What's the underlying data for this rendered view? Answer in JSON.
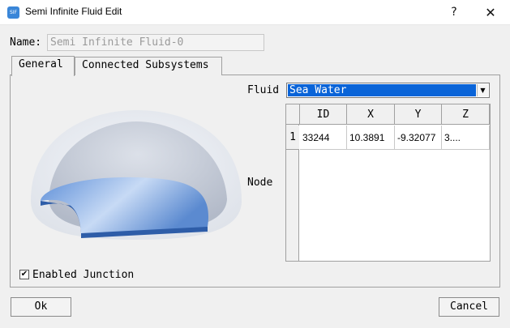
{
  "window": {
    "title": "Semi Infinite Fluid Edit",
    "icon_text": "SIF",
    "help_glyph": "?",
    "close_glyph": "✕"
  },
  "name": {
    "label": "Name:",
    "value": "Semi Infinite Fluid-0"
  },
  "tabs": [
    {
      "label": "General",
      "active": true
    },
    {
      "label": "Connected Subsystems",
      "active": false
    }
  ],
  "fluid": {
    "label": "Fluid",
    "selected": "Sea Water",
    "arrow_glyph": "▼"
  },
  "node": {
    "label": "Node",
    "columns": [
      "ID",
      "X",
      "Y",
      "Z"
    ],
    "rows": [
      {
        "index": "1",
        "cells": [
          "33244",
          "10.3891",
          "-9.32077",
          "3...."
        ]
      }
    ]
  },
  "enabled_junction": {
    "label": "Enabled Junction",
    "checked": true,
    "check_glyph": "✔"
  },
  "buttons": {
    "ok": "Ok",
    "cancel": "Cancel"
  },
  "colors": {
    "selection_blue": "#0a64d8",
    "plate_blue": "#5b8fd6"
  }
}
